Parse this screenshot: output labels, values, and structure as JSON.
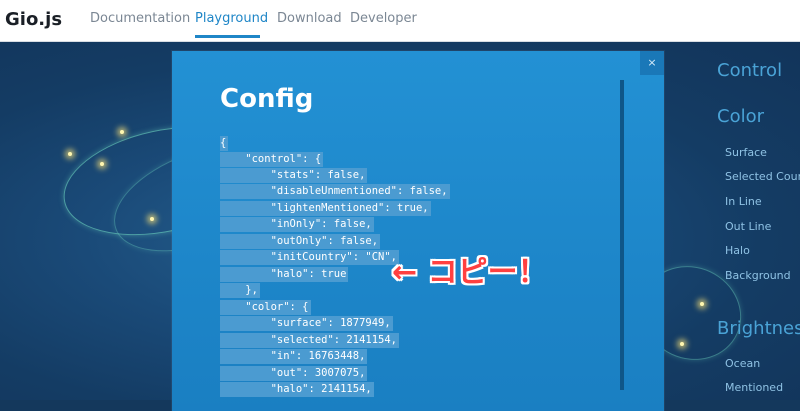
{
  "header": {
    "logo": "Gio.js",
    "nav": [
      {
        "label": "Documentation",
        "active": false
      },
      {
        "label": "Playground",
        "active": true
      },
      {
        "label": "Download",
        "active": false
      },
      {
        "label": "Developer",
        "active": false
      }
    ]
  },
  "side_panel": {
    "control": "Control",
    "color": "Color",
    "color_items": [
      "Surface",
      "Selected Count",
      "In Line",
      "Out Line",
      "Halo",
      "Background"
    ],
    "brightness": "Brightness",
    "brightness_items": [
      "Ocean",
      "Mentioned"
    ]
  },
  "modal": {
    "title": "Config",
    "close_label": "×",
    "code_lines": [
      "{",
      "    \"control\": {",
      "        \"stats\": false,",
      "        \"disableUnmentioned\": false,",
      "        \"lightenMentioned\": true,",
      "        \"inOnly\": false,",
      "        \"outOnly\": false,",
      "        \"initCountry\": \"CN\",",
      "        \"halo\": true",
      "    },",
      "    \"color\": {",
      "        \"surface\": 1877949,",
      "        \"selected\": 2141154,",
      "        \"in\": 16763448,",
      "        \"out\": 3007075,",
      "        \"halo\": 2141154,"
    ]
  },
  "annotation": "← コピー！",
  "colors": {
    "accent": "#1f86c7",
    "modal_bg": "#1e8cd0",
    "selection": "#4b9bd1",
    "annotation": "#ff4040"
  }
}
